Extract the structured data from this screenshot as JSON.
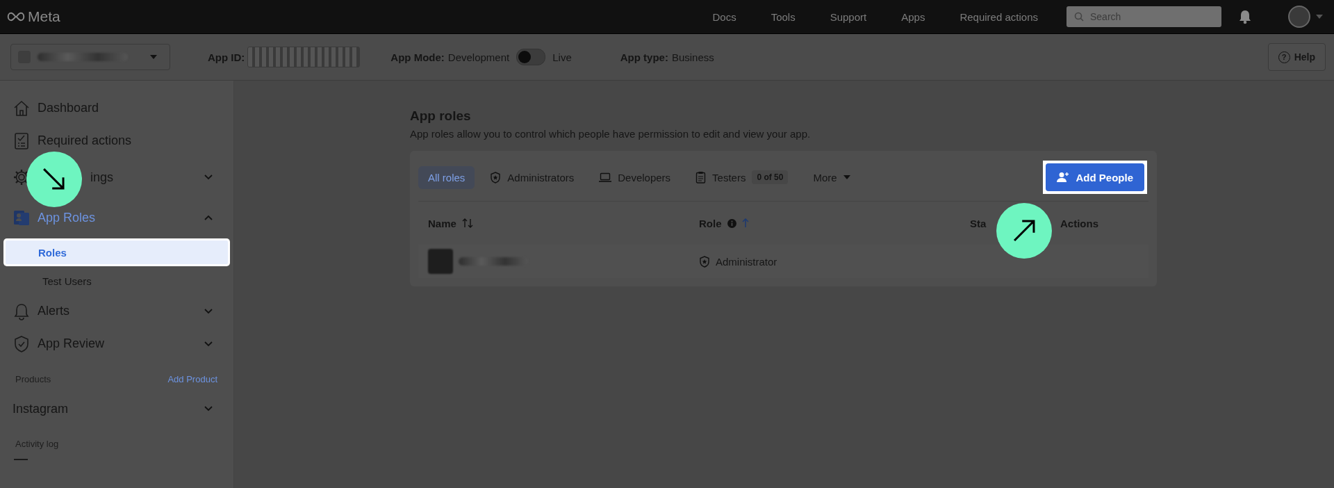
{
  "top_nav": {
    "logo": "Meta",
    "links": [
      "Docs",
      "Tools",
      "Support",
      "Apps",
      "Required actions"
    ],
    "search": {
      "placeholder": "Search"
    }
  },
  "app_bar": {
    "app_id_label": "App ID:",
    "app_mode_label": "App Mode:",
    "app_mode_value": "Development",
    "live_toggle": {
      "on": false
    },
    "live_label": "Live",
    "app_type_label": "App type:",
    "app_type_value": "Business",
    "help_icon": "?",
    "help": "Help"
  },
  "sidebar": {
    "items": [
      {
        "label": "Dashboard",
        "selected": false
      },
      {
        "label": "Required actions",
        "selected": false
      },
      {
        "label": "ings",
        "selected": false,
        "expanded": false
      },
      {
        "label": "App Roles",
        "selected": true,
        "expanded": true,
        "children": [
          {
            "label": "Roles",
            "selected": true
          },
          {
            "label": "Test Users",
            "selected": false
          }
        ]
      },
      {
        "label": "Alerts",
        "selected": false,
        "expanded": false
      },
      {
        "label": "App Review",
        "selected": false,
        "expanded": false
      }
    ],
    "products": {
      "label": "Products",
      "action": "Add Product",
      "items": [
        {
          "label": "Instagram",
          "expanded": false
        }
      ]
    },
    "activity_log": "Activity log"
  },
  "main": {
    "title": "App roles",
    "description": "App roles allow you to control which people have permission to edit and view your app.",
    "tabs": [
      {
        "label": "All roles",
        "selected": true
      },
      {
        "label": "Administrators",
        "selected": false
      },
      {
        "label": "Developers",
        "selected": false
      },
      {
        "label": "Testers",
        "selected": false,
        "count": "0 of 50"
      }
    ],
    "more": "More",
    "add_people": "Add People",
    "table": {
      "columns": [
        {
          "label": "Name",
          "kind": "sortable"
        },
        {
          "label": "Role",
          "kind": "sorted_up"
        },
        {
          "label": "Sta",
          "kind": "plain"
        },
        {
          "label": "Actions",
          "kind": "plain"
        }
      ],
      "rows": [
        {
          "role": "Administrator"
        }
      ]
    }
  }
}
